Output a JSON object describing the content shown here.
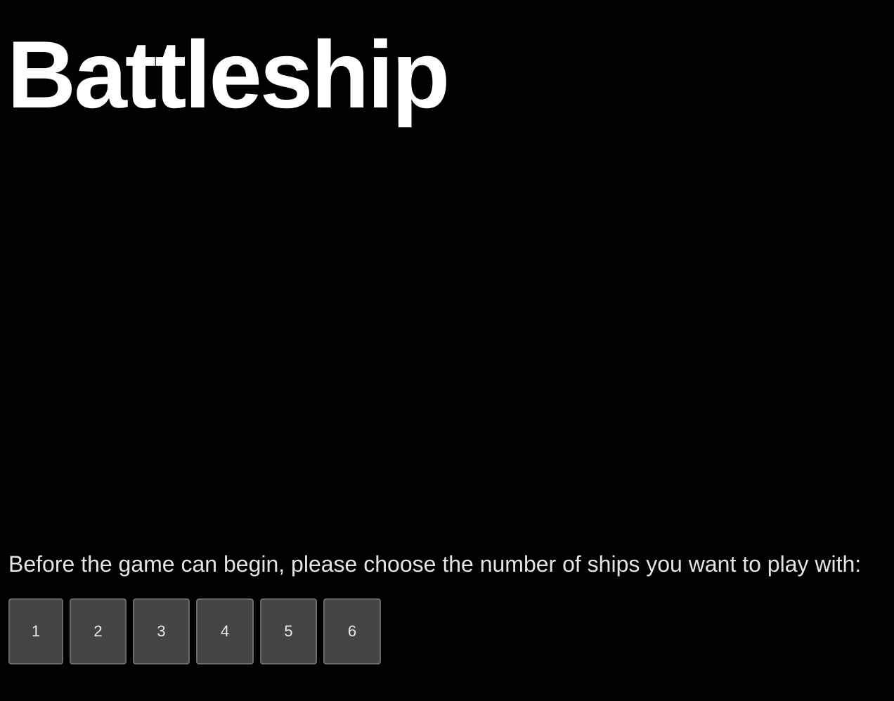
{
  "title": "Battleship",
  "prompt": "Before the game can begin, please choose the number of ships you want to play with:",
  "ship_options": [
    "1",
    "2",
    "3",
    "4",
    "5",
    "6"
  ],
  "colors": {
    "background": "#000000",
    "button_fill": "#444444",
    "button_border": "#6a6a6a",
    "text": "#ffffff"
  }
}
